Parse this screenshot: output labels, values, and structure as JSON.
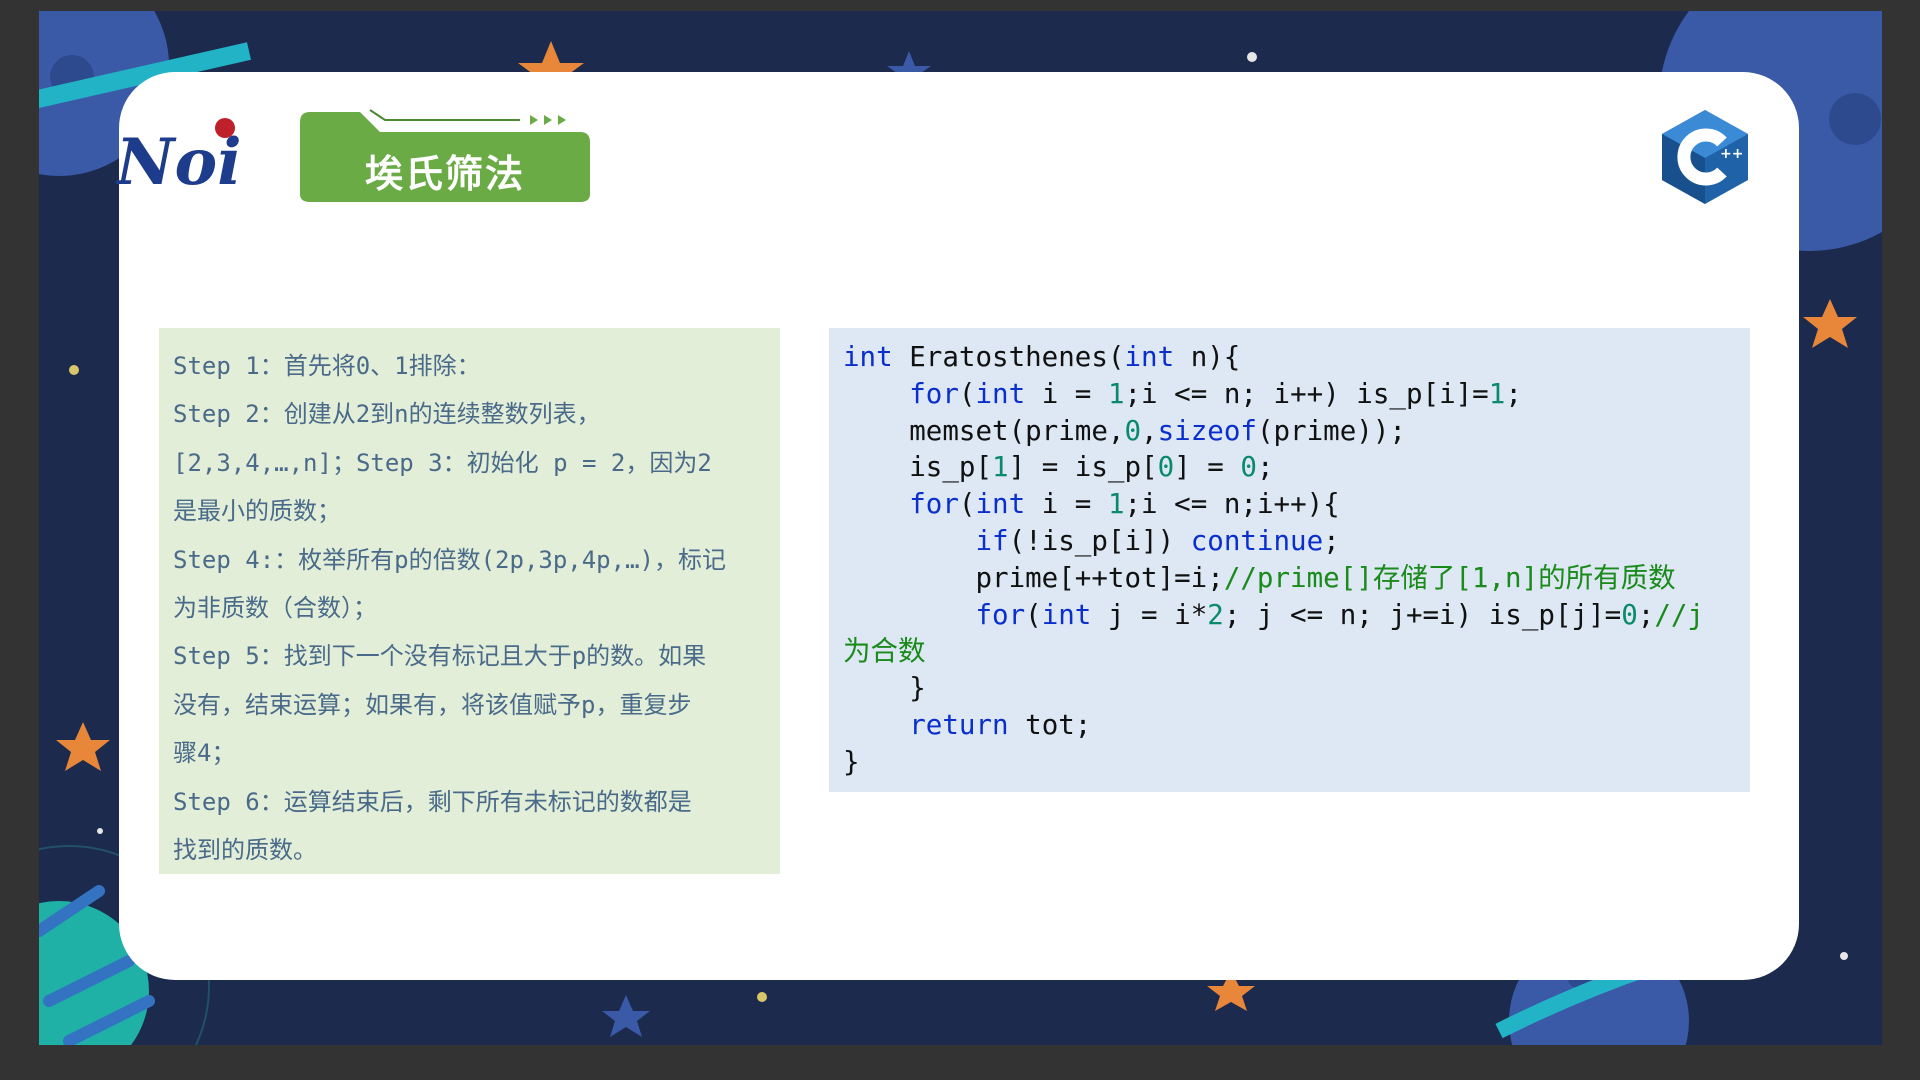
{
  "slide": {
    "title": "埃氏筛法",
    "logo_text": "Noi",
    "brand_logo": "cpp-logo-icon",
    "colors": {
      "background": "#1b2a4d",
      "card": "#ffffff",
      "title_tab": "#6aab45",
      "steps_bg": "#e2eed8",
      "code_bg": "#dde8f4",
      "keyword": "#0a2fcc",
      "number": "#0a8a6a",
      "comment": "#1a8a1a",
      "step_text": "#4a6a8a"
    }
  },
  "steps": [
    "Step 1：首先将0、1排除：",
    "Step 2：创建从2到n的连续整数列表，",
    "[2,3,4,…,n]；Step 3：初始化 p = 2，因为2",
    "是最小的质数；",
    "Step 4:：枚举所有p的倍数(2p,3p,4p,…)，标记",
    "为非质数（合数）；",
    "Step 5：找到下一个没有标记且大于p的数。如果",
    "没有，结束运算；如果有，将该值赋予p，重复步",
    "骤4；",
    "Step 6：运算结束后，剩下所有未标记的数都是",
    "找到的质数。"
  ],
  "code": {
    "l1": {
      "kw1": "int",
      "t1": " Eratosthenes(",
      "kw2": "int",
      "t2": " n){"
    },
    "l2": {
      "t0": "    ",
      "kw1": "for",
      "t1": "(",
      "kw2": "int",
      "t2": " i = ",
      "n1": "1",
      "t3": ";i <= n; i++) is_p[i]=",
      "n2": "1",
      "t4": ";"
    },
    "l3": {
      "t0": "    memset(prime,",
      "n1": "0",
      "t1": ",",
      "kw1": "sizeof",
      "t2": "(prime));"
    },
    "l4": {
      "t0": "    is_p[",
      "n1": "1",
      "t1": "] = is_p[",
      "n2": "0",
      "t2": "] = ",
      "n3": "0",
      "t3": ";"
    },
    "l5": {
      "t0": "    ",
      "kw1": "for",
      "t1": "(",
      "kw2": "int",
      "t2": " i = ",
      "n1": "1",
      "t3": ";i <= n;i++){"
    },
    "l6": {
      "t0": "        ",
      "kw1": "if",
      "t1": "(!is_p[i]) ",
      "kw2": "continue",
      "t2": ";"
    },
    "l7": {
      "t0": "        prime[++tot]=i;",
      "c1": "//prime[]存储了[1,n]的所有质数"
    },
    "l8": {
      "t0": "        ",
      "kw1": "for",
      "t1": "(",
      "kw2": "int",
      "t2": " j = i*",
      "n1": "2",
      "t3": "; j <= n; j+=i) is_p[j]=",
      "n2": "0",
      "t4": ";",
      "c1": "//j"
    },
    "l9": {
      "c1": "为合数"
    },
    "l10": {
      "t0": "    }"
    },
    "l11": {
      "t0": "    ",
      "kw1": "return",
      "t1": " tot;"
    },
    "l12": {
      "t0": "}"
    }
  }
}
